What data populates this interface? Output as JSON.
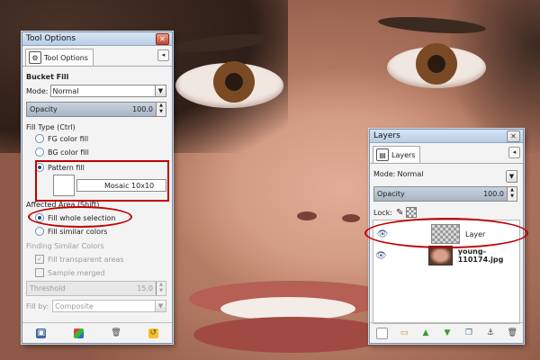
{
  "tool_options": {
    "title": "Tool Options",
    "tab_label": "Tool Options",
    "tool_name": "Bucket Fill",
    "mode_label": "Mode:",
    "mode_value": "Normal",
    "opacity_label": "Opacity",
    "opacity_value": "100.0",
    "fill_type_label": "Fill Type  (Ctrl)",
    "fill_types": [
      "FG color fill",
      "BG color fill",
      "Pattern fill"
    ],
    "selected_fill_type": "Pattern fill",
    "pattern_name": "Mosaic 10x10",
    "affected_area_label": "Affected Area  (Shift)",
    "affected_areas": [
      "Fill whole selection",
      "Fill similar colors"
    ],
    "selected_affected_area": "Fill whole selection",
    "finding_similar_label": "Finding Similar Colors",
    "fill_transparent_label": "Fill transparent areas",
    "fill_transparent_checked": true,
    "sample_merged_label": "Sample merged",
    "sample_merged_checked": false,
    "threshold_label": "Threshold",
    "threshold_value": "15.0",
    "fill_by_label": "Fill by:",
    "fill_by_value": "Composite"
  },
  "layers": {
    "title": "Layers",
    "tab_label": "Layers",
    "mode_label": "Mode:",
    "mode_value": "Normal",
    "opacity_label": "Opacity",
    "opacity_value": "100.0",
    "lock_label": "Lock:",
    "items": [
      {
        "name": "Layer",
        "visible": true,
        "selected": true
      },
      {
        "name": "young-110174.jpg",
        "visible": true,
        "selected": false
      }
    ]
  },
  "colors": {
    "highlight": "#c00000",
    "titlebar": "#c6d8ee",
    "selected_row": "#ffffff"
  },
  "icons": {
    "tool_options_bottom": [
      "save-preset-icon",
      "restore-preset-icon",
      "delete-preset-icon",
      "reset-icon"
    ],
    "layers_bottom": [
      "new-layer-icon",
      "new-group-icon",
      "raise-layer-icon",
      "lower-layer-icon",
      "duplicate-layer-icon",
      "anchor-layer-icon",
      "delete-layer-icon"
    ]
  }
}
